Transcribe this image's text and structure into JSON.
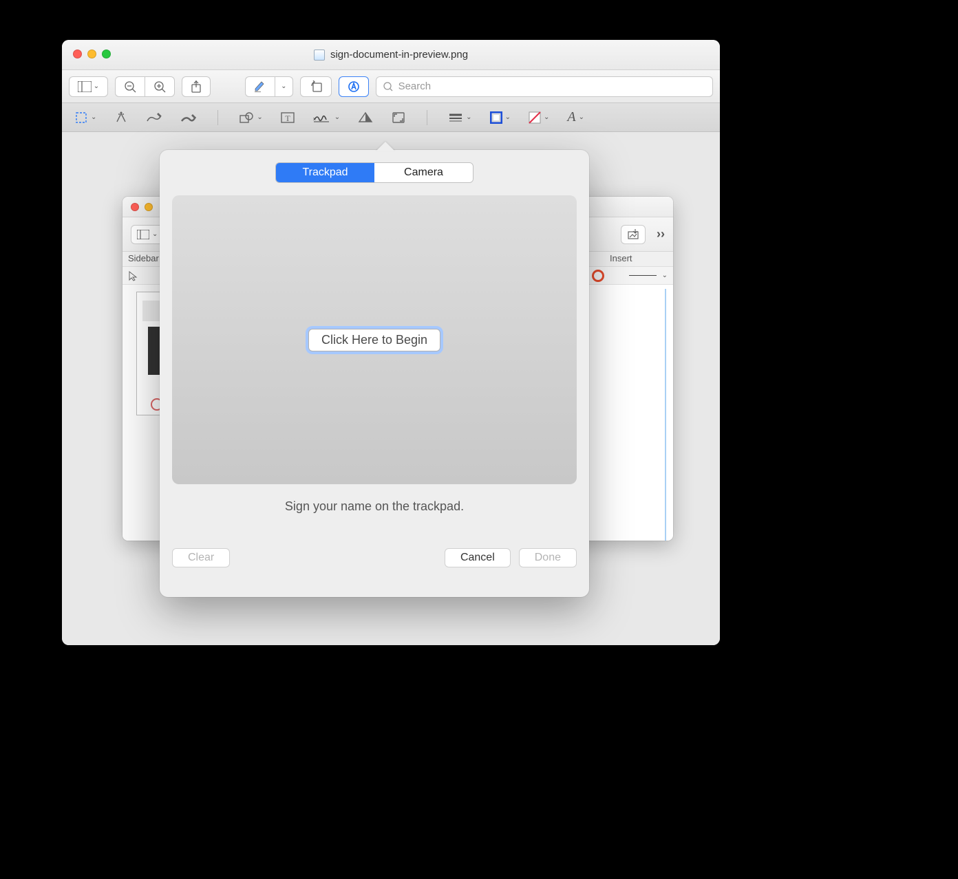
{
  "window": {
    "title": "sign-document-in-preview.png",
    "search_placeholder": "Search"
  },
  "main_toolbar": {
    "sidebar": "sidebar-icon",
    "zoom_out": "zoom-out-icon",
    "zoom_in": "zoom-in-icon",
    "share": "share-icon",
    "highlight": "highlight-icon",
    "rotate": "rotate-icon",
    "markup": "markup-icon"
  },
  "markup_toolbar": {
    "select": "selection-icon",
    "instant_alpha": "instant-alpha-icon",
    "sketch": "sketch-icon",
    "draw": "draw-icon",
    "shapes": "shapes-icon",
    "text": "text-icon",
    "sign": "sign-icon",
    "adjust_color": "adjust-color-icon",
    "adjust_size": "adjust-size-icon",
    "border_style": "border-style-icon",
    "border_color": "border-color-icon",
    "fill_color": "fill-color-icon",
    "font_style": "font-style-icon"
  },
  "inner_window": {
    "labels": {
      "sidebar": "Sidebar",
      "insert": "Insert"
    },
    "more": "more-icon"
  },
  "popover": {
    "tabs": {
      "trackpad": "Trackpad",
      "camera": "Camera",
      "active": "trackpad"
    },
    "begin_label": "Click Here to Begin",
    "instruction": "Sign your name on the trackpad.",
    "clear_label": "Clear",
    "cancel_label": "Cancel",
    "done_label": "Done"
  }
}
